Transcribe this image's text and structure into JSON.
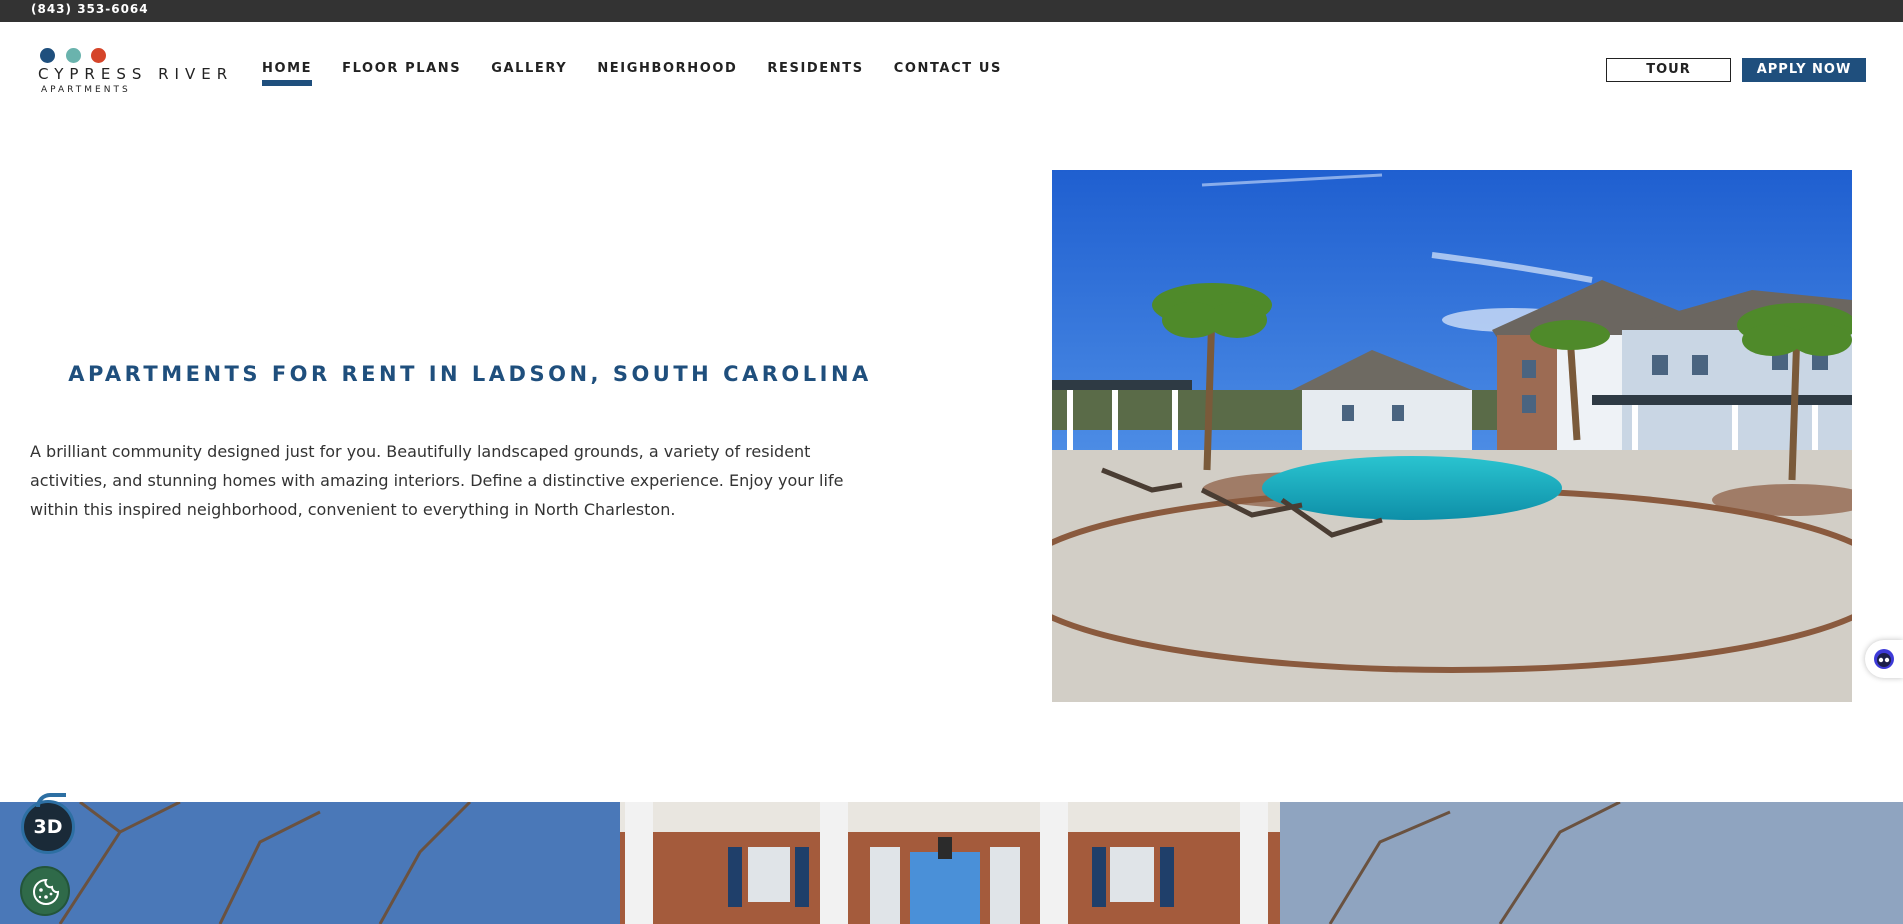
{
  "topbar": {
    "phone": "(843) 353-6064"
  },
  "logo": {
    "name": "CYPRESS RIVER",
    "subtitle": "APARTMENTS",
    "dot_colors": [
      "#1f4f7d",
      "#6ab3ad",
      "#d5452a"
    ]
  },
  "nav": {
    "items": [
      {
        "label": "HOME",
        "active": true
      },
      {
        "label": "FLOOR PLANS",
        "active": false
      },
      {
        "label": "GALLERY",
        "active": false
      },
      {
        "label": "NEIGHBORHOOD",
        "active": false
      },
      {
        "label": "RESIDENTS",
        "active": false
      },
      {
        "label": "CONTACT US",
        "active": false
      }
    ]
  },
  "header_buttons": {
    "tour": "TOUR",
    "apply": "APPLY NOW"
  },
  "main": {
    "heading": "APARTMENTS FOR RENT IN LADSON, SOUTH CAROLINA",
    "intro": "A brilliant community designed just for you. Beautifully landscaped grounds, a variety of resident activities, and stunning homes with amazing interiors. Define a distinctive experience. Enjoy your life within this inspired neighborhood, convenient to everything in North Charleston."
  },
  "floating": {
    "tour_3d_label": "3D"
  },
  "icons": [
    "phone-icon",
    "3d-tour-icon",
    "cookie-icon",
    "chat-widget-icon"
  ],
  "colors": {
    "brand_blue": "#1f4f7d",
    "topbar_bg": "#333333",
    "accent_teal": "#6ab3ad",
    "accent_red": "#d5452a",
    "cookie_green": "#2f6a49"
  }
}
